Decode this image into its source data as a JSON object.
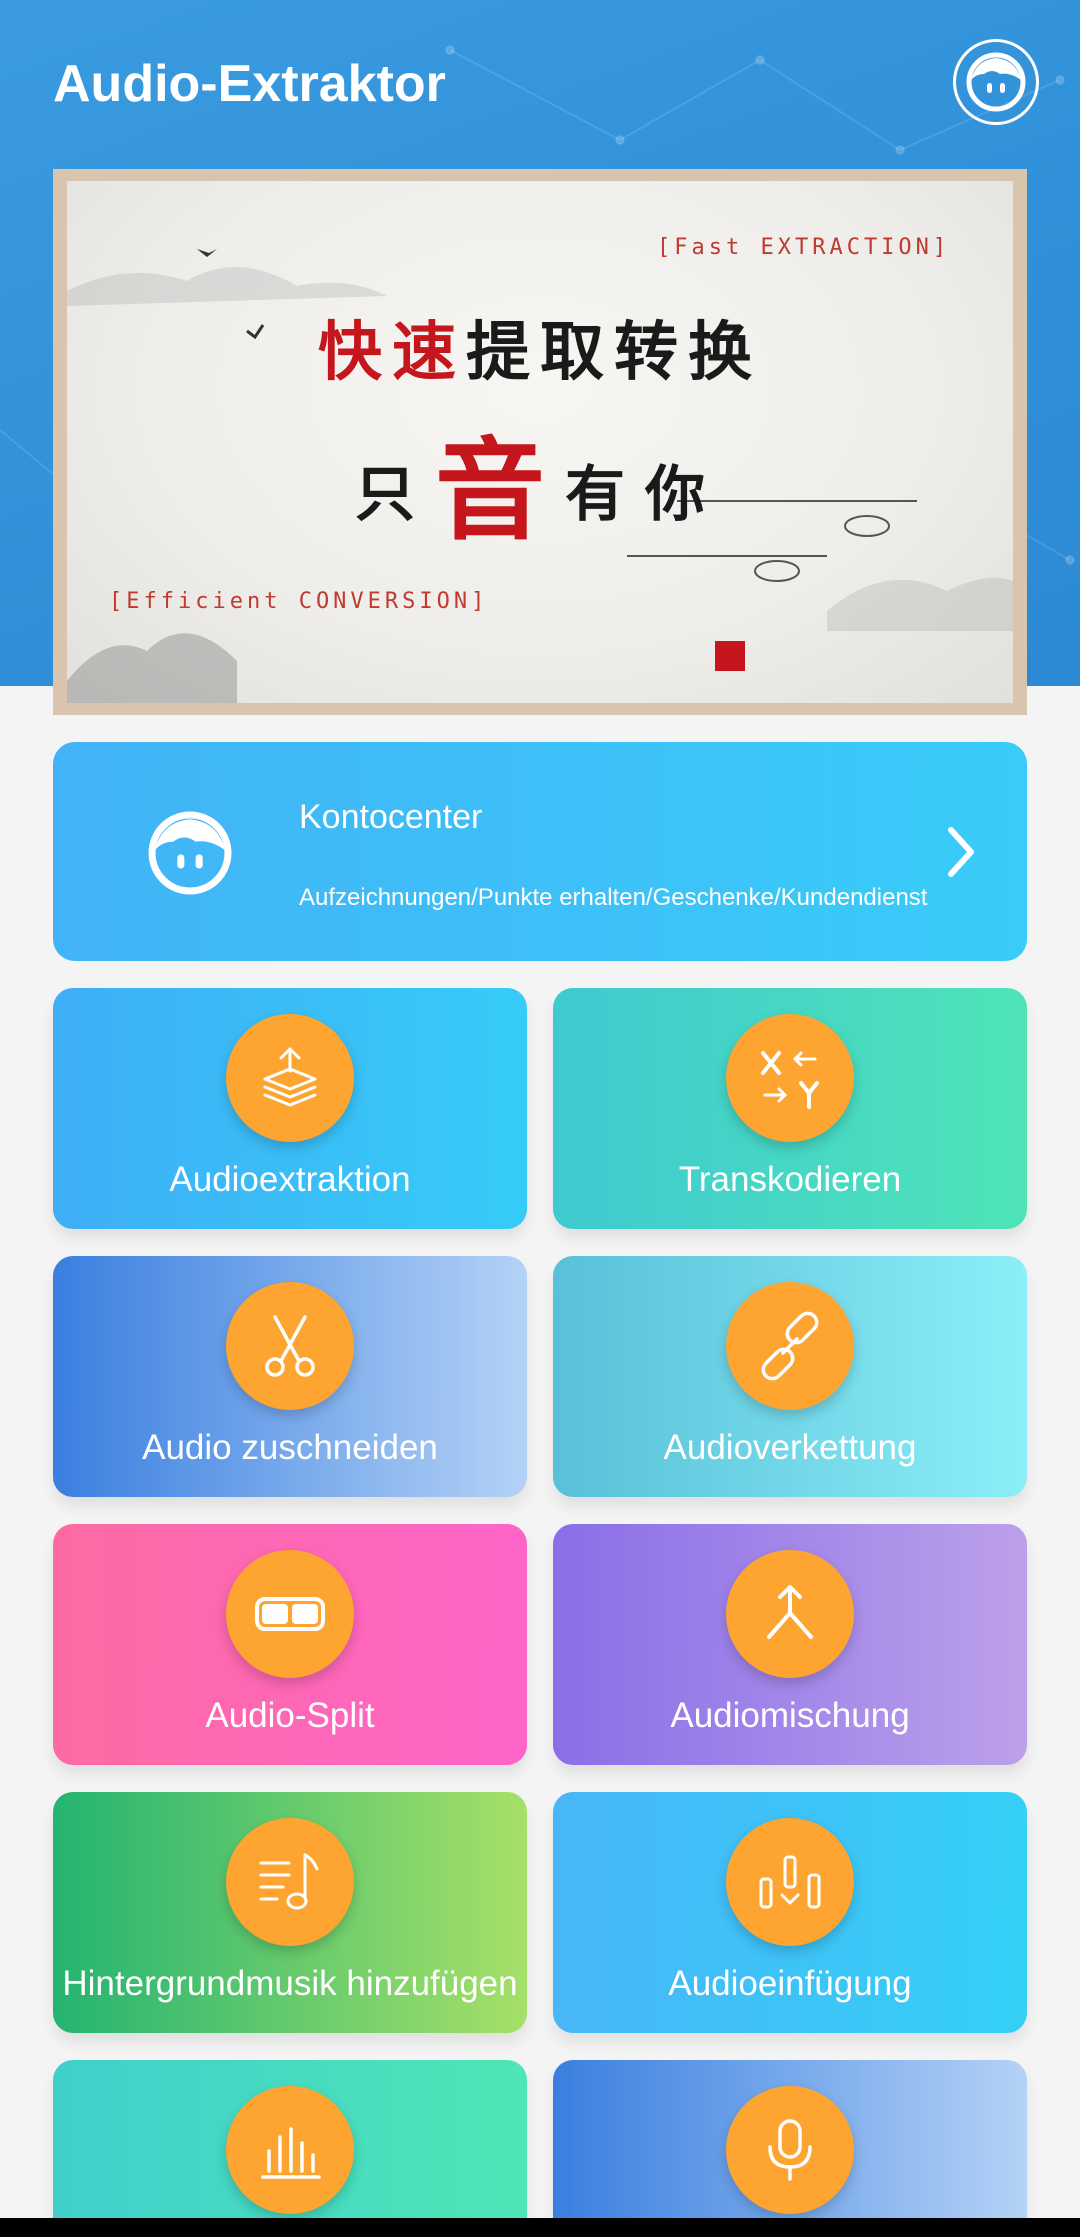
{
  "header": {
    "title": "Audio-Extraktor",
    "avatar_icon": "user-face-icon",
    "bg_color": "#3a9be0"
  },
  "banner": {
    "tag_top": "[Fast EXTRACTION]",
    "line1_red": "快速",
    "line1_black": "提取转换",
    "line2_a": "只",
    "line2_big": "音",
    "line2_b": "有你",
    "tag_bottom": "[Efficient CONVERSION]"
  },
  "account": {
    "title": "Kontocenter",
    "subtitle": "Aufzeichnungen/Punkte erhalten/Geschenke/Kundendienst",
    "icon": "user-face-icon",
    "chevron": "chevron-right-icon"
  },
  "tiles": [
    {
      "label": "Audioextraktion",
      "icon": "layers-upload-icon"
    },
    {
      "label": "Transkodieren",
      "icon": "transcode-xy-icon"
    },
    {
      "label": "Audio zuschneiden",
      "icon": "scissors-icon"
    },
    {
      "label": "Audioverkettung",
      "icon": "link-icon"
    },
    {
      "label": "Audio-Split",
      "icon": "split-icon"
    },
    {
      "label": "Audiomischung",
      "icon": "merge-icon"
    },
    {
      "label": "Hintergrundmusik hinzufügen",
      "icon": "music-list-icon"
    },
    {
      "label": "Audioeinfügung",
      "icon": "audio-insert-icon"
    },
    {
      "label": "",
      "icon": "equalizer-icon"
    },
    {
      "label": "",
      "icon": "microphone-icon"
    }
  ],
  "colors": {
    "accent_orange": "#fda530"
  }
}
